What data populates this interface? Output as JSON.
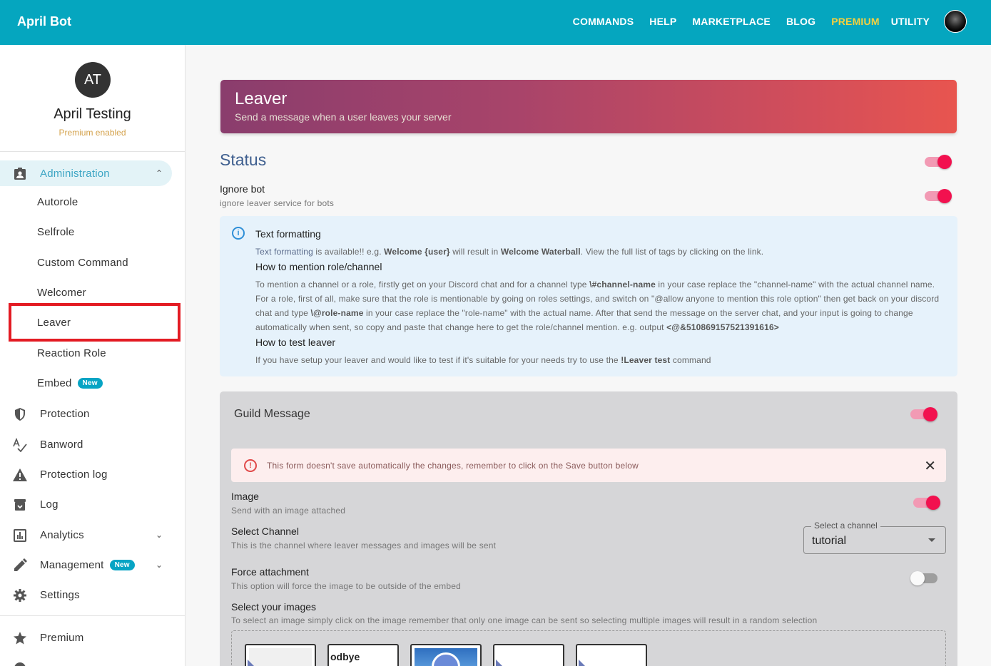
{
  "app": {
    "title": "April Bot"
  },
  "nav": {
    "items": [
      "COMMANDS",
      "HELP",
      "MARKETPLACE",
      "BLOG",
      "PREMIUM",
      "UTILITY"
    ],
    "premium_color": "#f4d03f"
  },
  "profile": {
    "initials": "AT",
    "name": "April Testing",
    "status": "Premium enabled"
  },
  "sidebar": {
    "administration": "Administration",
    "sub_items": [
      "Autorole",
      "Selfrole",
      "Custom Command",
      "Welcomer",
      "Leaver",
      "Reaction Role",
      "Embed"
    ],
    "new_badge": "New",
    "items": [
      "Protection",
      "Banword",
      "Protection log",
      "Log",
      "Analytics",
      "Management",
      "Settings"
    ],
    "bottom_items": [
      "Premium"
    ]
  },
  "hero": {
    "title": "Leaver",
    "subtitle": "Send a message when a user leaves your server"
  },
  "status": {
    "title": "Status",
    "enabled": true,
    "ignore_bot": {
      "title": "Ignore bot",
      "subtitle": "ignore leaver service for bots",
      "enabled": true
    }
  },
  "info": {
    "h1": "Text formatting",
    "p1_link": "Text formatting",
    "p1_a": " is available!! e.g. ",
    "p1_b1": "Welcome {user}",
    "p1_c": " will result in ",
    "p1_b2": "Welcome Waterball",
    "p1_d": ". View the full list of tags by clicking on the link.",
    "h2": "How to mention role/channel",
    "p2_a": "To mention a channel or a role, firstly get on your Discord chat and for a channel type ",
    "p2_b1": "\\#channel-name",
    "p2_c": " in your case replace the \"channel-name\" with the actual channel name. For a role, first of all, make sure that the role is mentionable by going on roles settings, and switch on \"@allow anyone to mention this role option\" then get back on your discord chat and type ",
    "p2_b2": "\\@role-name",
    "p2_d": " in your case replace the \"role-name\" with the actual name. After that send the message on the server chat, and your input is going to change automatically when sent, so copy and paste that change here to get the role/channel mention. e.g. output ",
    "p2_b3": "<@&510869157521391616>",
    "h3": "How to test leaver",
    "p3_a": "If you have setup your leaver and would like to test if it's suitable for your needs try to use the ",
    "p3_b": "!Leaver test",
    "p3_c": " command"
  },
  "guild": {
    "title": "Guild Message",
    "enabled": true,
    "alert": "This form doesn't save automatically the changes, remember to click on the Save button below",
    "image": {
      "title": "Image",
      "subtitle": "Send with an image attached",
      "enabled": true
    },
    "channel": {
      "title": "Select Channel",
      "subtitle": "This is the channel where leaver messages and images will be sent",
      "label": "Select a channel",
      "value": "tutorial"
    },
    "force": {
      "title": "Force attachment",
      "subtitle": "This option will force the image to be outside of the embed",
      "enabled": false
    },
    "images": {
      "title": "Select your images",
      "subtitle": "To select an image simply click on the image remember that only one image can be sent so selecting multiple images will result in a random selection",
      "thumb_text": "odbye"
    }
  }
}
